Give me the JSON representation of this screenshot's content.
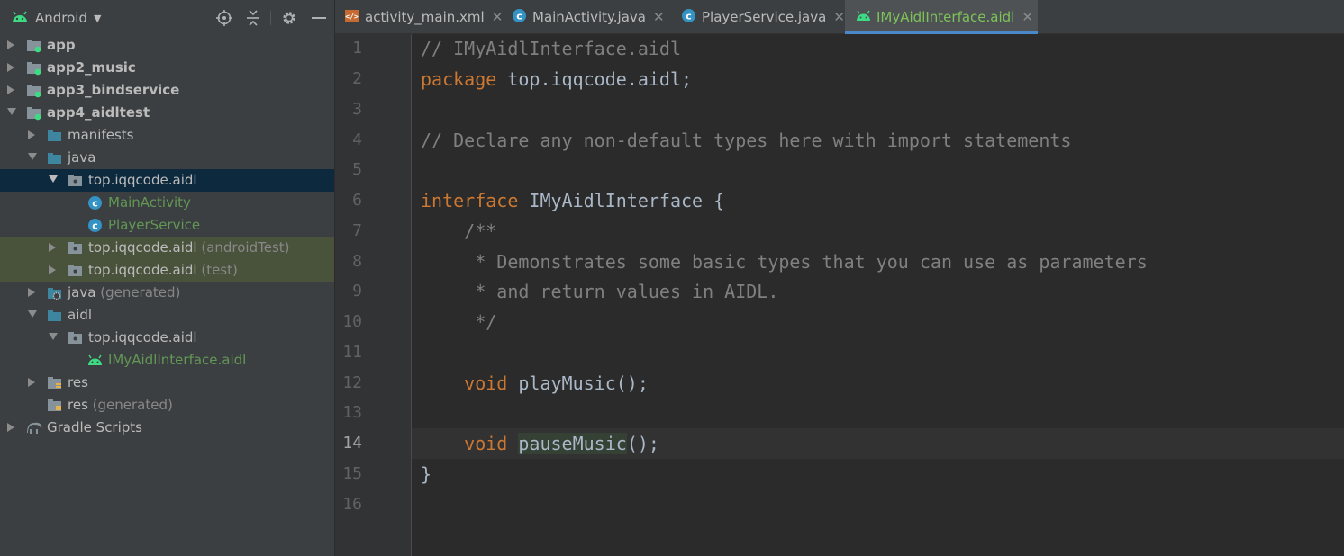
{
  "project_panel": {
    "view_label": "Android",
    "colors": {
      "background": "#3c3f41",
      "selected_row": "#0d293e",
      "test_row": "#49523b",
      "module_green": "#629755"
    },
    "tree": [
      {
        "label": "app",
        "suffix": ""
      },
      {
        "label": "app2_music",
        "suffix": ""
      },
      {
        "label": "app3_bindservice",
        "suffix": ""
      },
      {
        "label": "app4_aidltest",
        "suffix": ""
      },
      {
        "label": "manifests",
        "suffix": ""
      },
      {
        "label": "java",
        "suffix": ""
      },
      {
        "label": "top.iqqcode.aidl",
        "suffix": ""
      },
      {
        "label": "MainActivity",
        "suffix": ""
      },
      {
        "label": "PlayerService",
        "suffix": ""
      },
      {
        "label": "top.iqqcode.aidl",
        "suffix": "(androidTest)"
      },
      {
        "label": "top.iqqcode.aidl",
        "suffix": "(test)"
      },
      {
        "label": "java",
        "suffix": "(generated)"
      },
      {
        "label": "aidl",
        "suffix": ""
      },
      {
        "label": "top.iqqcode.aidl",
        "suffix": ""
      },
      {
        "label": "IMyAidlInterface.aidl",
        "suffix": ""
      },
      {
        "label": "res",
        "suffix": ""
      },
      {
        "label": "res",
        "suffix": "(generated)"
      },
      {
        "label": "Gradle Scripts",
        "suffix": ""
      }
    ]
  },
  "tabs": [
    {
      "label": "activity_main.xml",
      "icon": "xml-layout-icon",
      "active": false
    },
    {
      "label": "MainActivity.java",
      "icon": "java-class-icon",
      "active": false
    },
    {
      "label": "PlayerService.java",
      "icon": "java-class-icon",
      "active": false
    },
    {
      "label": "IMyAidlInterface.aidl",
      "icon": "android-icon",
      "active": true
    }
  ],
  "editor": {
    "current_line": 14,
    "line_numbers": [
      "1",
      "2",
      "3",
      "4",
      "5",
      "6",
      "7",
      "8",
      "9",
      "10",
      "11",
      "12",
      "13",
      "14",
      "15",
      "16"
    ],
    "code": {
      "l1": "// IMyAidlInterface.aidl",
      "l2_kw": "package",
      "l2_rest": " top.iqqcode.aidl;",
      "l4": "// Declare any non-default types here with import statements",
      "l6_kw": "interface",
      "l6_rest": " IMyAidlInterface {",
      "l7": "    /**",
      "l8": "     * Demonstrates some basic types that you can use as parameters",
      "l9": "     * and return values in AIDL.",
      "l10": "     */",
      "l12_indent": "    ",
      "l12_kw": "void",
      "l12_rest": " playMusic();",
      "l14_indent": "    ",
      "l14_kw": "void",
      "l14_space": " ",
      "l14_hl": "pauseMusic",
      "l14_rest": "();",
      "l15": "}"
    },
    "colors": {
      "background": "#2b2b2b",
      "keyword": "#cc7832",
      "comment": "#808080",
      "text": "#a9b7c6"
    }
  }
}
